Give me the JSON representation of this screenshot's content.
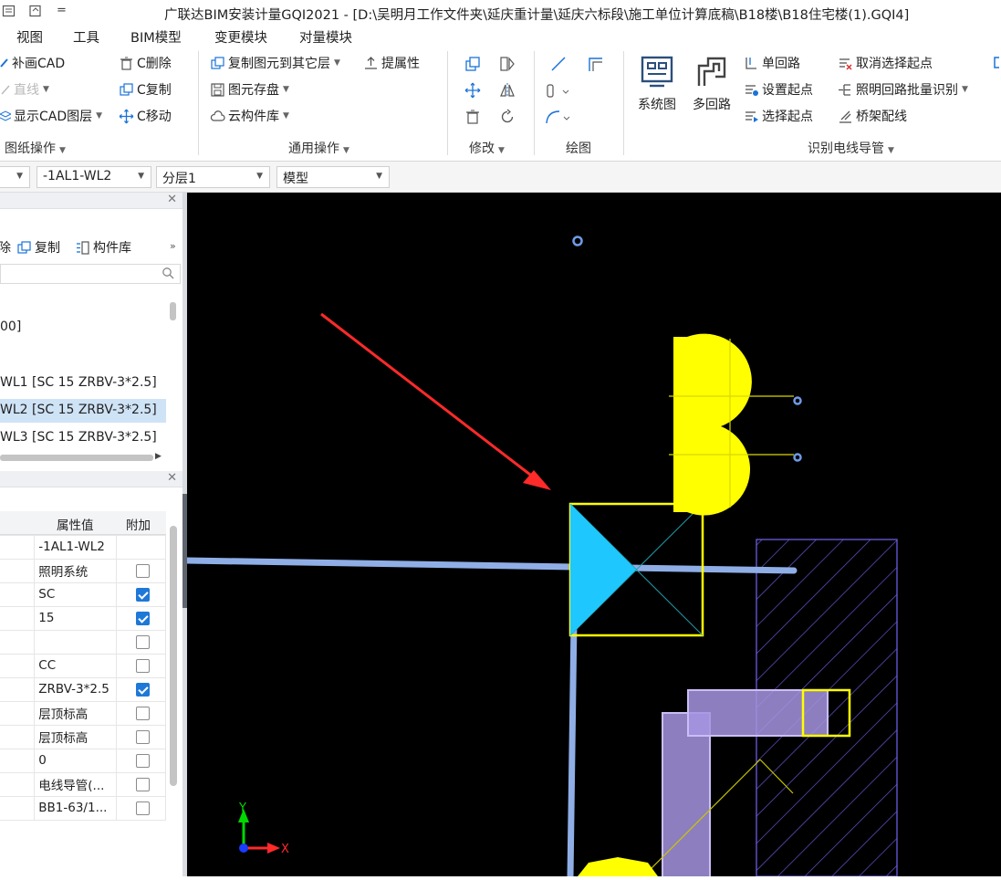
{
  "titlebar": {
    "title": "广联达BIM安装计量GQI2021 - [D:\\吴明月工作文件夹\\延庆重计量\\延庆六标段\\施工单位计算底稿\\B18楼\\B18住宅楼(1).GQI4]",
    "quick_access_menu": "="
  },
  "menubar": {
    "items": [
      "视图",
      "工具",
      "BIM模型",
      "变更模块",
      "对量模块"
    ]
  },
  "ribbon": {
    "drawing_ops": {
      "items": [
        "补画CAD",
        "直线",
        "显示CAD图层",
        "C删除",
        "C复制",
        "C移动"
      ],
      "label": "图纸操作"
    },
    "common_ops": {
      "items": [
        "复制图元到其它层",
        "提属性",
        "图元存盘",
        "云构件库"
      ],
      "label": "通用操作"
    },
    "modify": {
      "label": "修改"
    },
    "draw": {
      "label": "绘图"
    },
    "recognize": {
      "system_diagram": "系统图",
      "multi_circuit": "多回路",
      "items": [
        "单回路",
        "设置起点",
        "选择起点",
        "取消选择起点",
        "照明回路批量识别",
        "桥架配线"
      ],
      "label": "识别电线导管"
    }
  },
  "filterbar": {
    "circuit": "-1AL1-WL2",
    "layer": "分层1",
    "view": "模型"
  },
  "component_panel": {
    "toolbar": [
      "除",
      "复制",
      "构件库"
    ],
    "tree_items": [
      "00]",
      "WL1 [SC 15 ZRBV-3*2.5]",
      "WL2 [SC 15 ZRBV-3*2.5]",
      "WL3 [SC 15 ZRBV-3*2.5]"
    ],
    "selected_index": 2
  },
  "properties": {
    "col_value": "属性值",
    "col_extra": "附加",
    "rows": [
      {
        "value": "-1AL1-WL2",
        "extra": null
      },
      {
        "value": "照明系统",
        "extra": false
      },
      {
        "value": "SC",
        "extra": true
      },
      {
        "value": "15",
        "extra": true
      },
      {
        "value": "",
        "extra": false
      },
      {
        "value": "CC",
        "extra": false
      },
      {
        "value": "ZRBV-3*2.5",
        "extra": true
      },
      {
        "value": "层顶标高",
        "extra": false
      },
      {
        "value": "层顶标高",
        "extra": false
      },
      {
        "value": "0",
        "extra": false
      },
      {
        "value": "电线导管(...",
        "extra": false
      },
      {
        "value": "BB1-63/1...",
        "extra": false
      }
    ]
  },
  "canvas": {
    "background": "#000000",
    "axis_y": "Y",
    "axis_x": "X",
    "colors": {
      "pipe": "#8faee6",
      "device_fill": "#1ec8ff",
      "device_frame": "#ffff00",
      "fixture": "#ffff00",
      "wall": "#7b68ee",
      "duct": "#b9a6ef",
      "annotation_arrow": "#ff2a2a"
    }
  }
}
